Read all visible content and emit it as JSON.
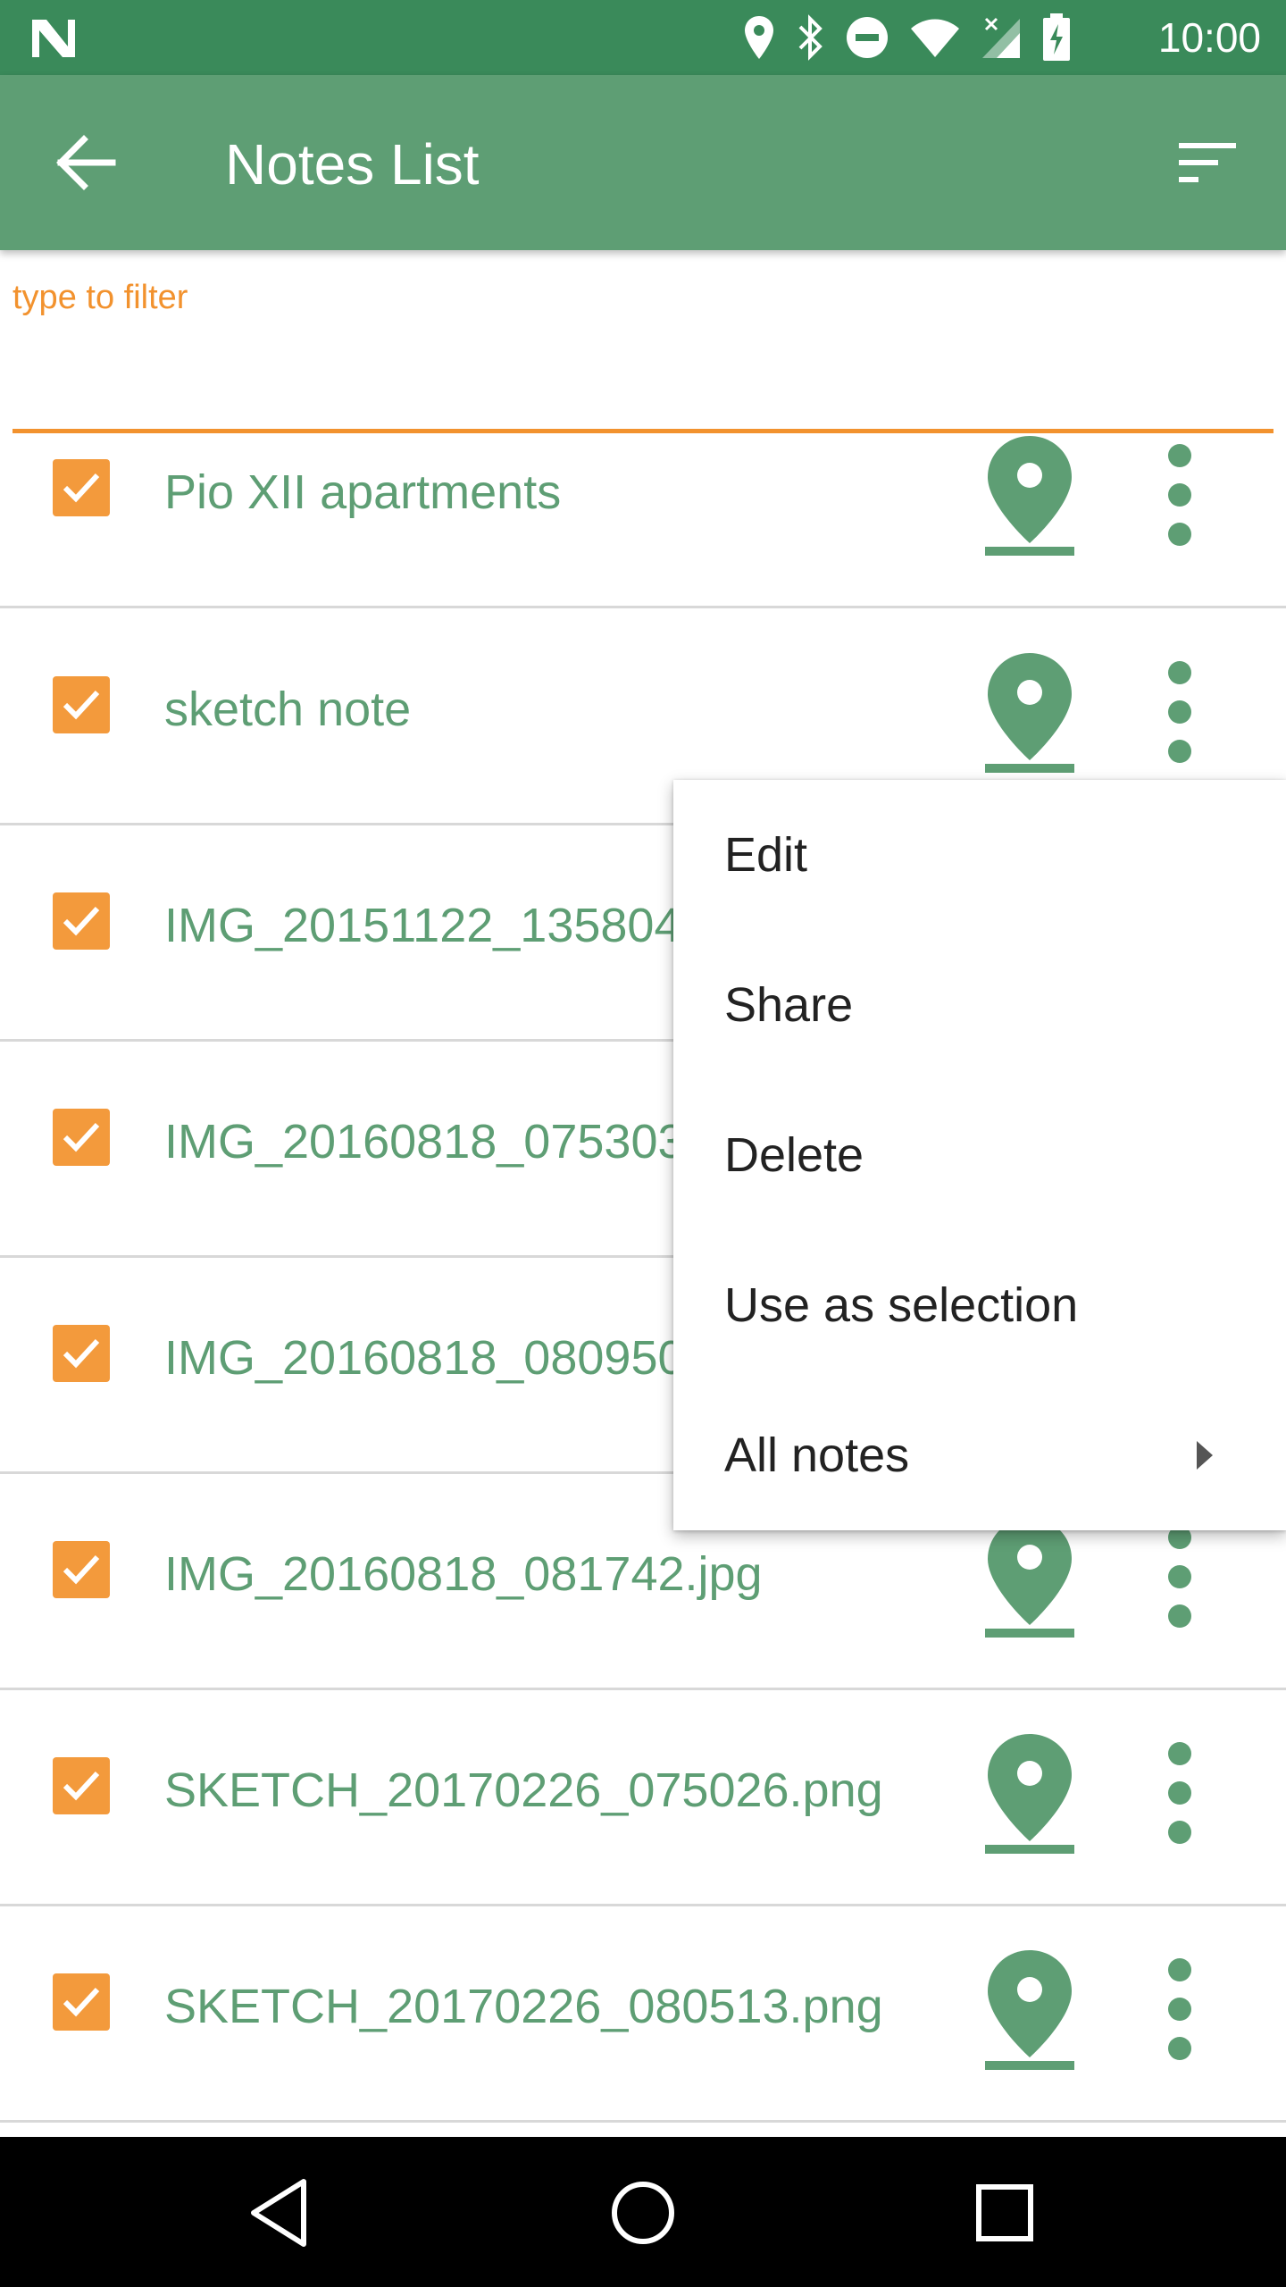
{
  "status_bar": {
    "time": "10:00",
    "icons": [
      "n-logo-icon",
      "location-icon",
      "bluetooth-icon",
      "do-not-disturb-icon",
      "wifi-icon",
      "cellular-no-signal-icon",
      "battery-charging-icon"
    ]
  },
  "app_bar": {
    "title": "Notes List",
    "back_icon": "arrow-back-icon",
    "sort_icon": "sort-icon"
  },
  "filter": {
    "placeholder": "type to filter",
    "value": ""
  },
  "notes": [
    {
      "title": "Pio XII apartments",
      "checked": true
    },
    {
      "title": "sketch note",
      "checked": true
    },
    {
      "title": "IMG_20151122_135804",
      "checked": true
    },
    {
      "title": "IMG_20160818_075303",
      "checked": true
    },
    {
      "title": "IMG_20160818_080950",
      "checked": true
    },
    {
      "title": "IMG_20160818_081742.jpg",
      "checked": true
    },
    {
      "title": "SKETCH_20170226_075026.png",
      "checked": true
    },
    {
      "title": "SKETCH_20170226_080513.png",
      "checked": true
    }
  ],
  "context_menu": {
    "items": [
      {
        "label": "Edit"
      },
      {
        "label": "Share"
      },
      {
        "label": "Delete"
      },
      {
        "label": "Use as selection"
      },
      {
        "label": "All notes",
        "has_submenu": true
      }
    ]
  },
  "nav_bar": {
    "buttons": [
      "back-triangle-icon",
      "home-circle-icon",
      "recents-square-icon"
    ]
  },
  "colors": {
    "status_bar": "#3a8a5a",
    "app_bar": "#5e9e74",
    "accent_orange": "#f2922e",
    "note_text": "#5e9e74"
  }
}
